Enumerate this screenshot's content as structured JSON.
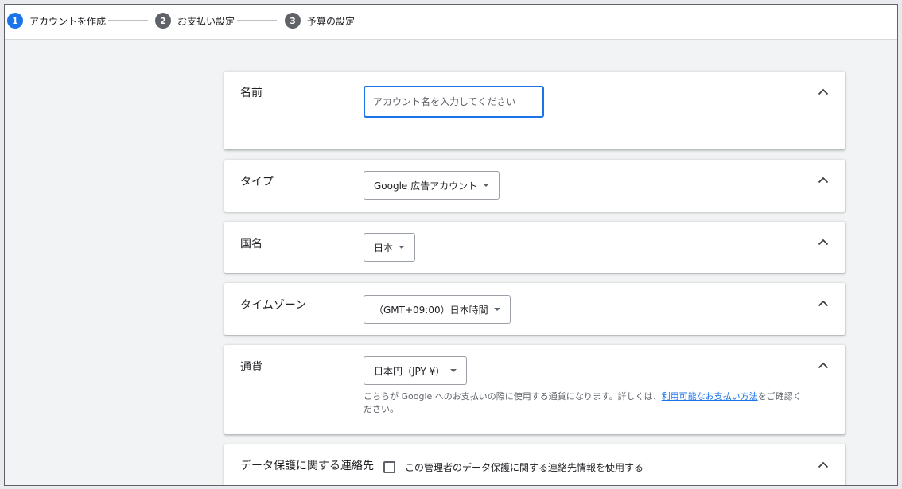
{
  "stepper": {
    "steps": [
      {
        "number": "1",
        "label": "アカウントを作成"
      },
      {
        "number": "2",
        "label": "お支払い設定"
      },
      {
        "number": "3",
        "label": "予算の設定"
      }
    ]
  },
  "sections": {
    "name": {
      "label": "名前",
      "placeholder": "アカウント名を入力してください"
    },
    "type": {
      "label": "タイプ",
      "value": "Google 広告アカウント"
    },
    "country": {
      "label": "国名",
      "value": "日本"
    },
    "timezone": {
      "label": "タイムゾーン",
      "value": "（GMT+09:00）日本時間"
    },
    "currency": {
      "label": "通貨",
      "value": "日本円（JPY ¥）",
      "help_before": "こちらが Google へのお支払いの際に使用する通貨になります。詳しくは、",
      "help_link": "利用可能なお支払い方法",
      "help_after": "をご確認ください。"
    },
    "privacy": {
      "label": "データ保護に関する連絡先",
      "checkbox_label": "この管理者のデータ保護に関する連絡先情報を使用する",
      "checked": false
    }
  },
  "icons": {
    "collapse": "chevron-up-icon",
    "dropdown": "caret-down-icon"
  },
  "colors": {
    "accent": "#1a73e8",
    "inactive_step": "#5f6368",
    "background": "#f1f3f4"
  }
}
